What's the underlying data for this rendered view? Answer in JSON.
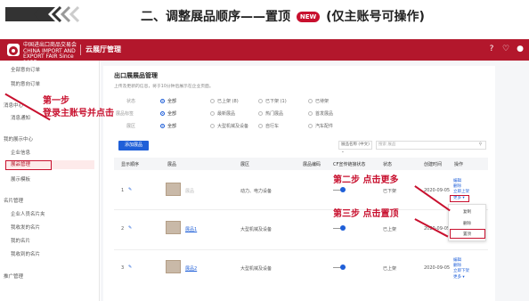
{
  "slide": {
    "title_prefix": "二、调整展品顺序——置顶",
    "new_badge": "NEW",
    "title_suffix": "(仅主账号可操作)"
  },
  "topbar": {
    "logo_text": "中国进出口商品交易会 CHINA IMPORT AND EXPORT FAIR Since 1957",
    "app_name": "云展厅管理",
    "icons": [
      "help-icon",
      "bell-icon",
      "user-icon"
    ]
  },
  "sidebar": {
    "items": [
      {
        "label": "全部意向订单",
        "active": false
      },
      {
        "label": "我的意向订单",
        "active": false
      },
      {
        "label": "消息中心",
        "active": false
      },
      {
        "label": "消息通知",
        "active": false
      },
      {
        "label": "我的展示中心",
        "active": false
      },
      {
        "label": "企业信息",
        "active": false
      },
      {
        "label": "展品管理",
        "active": true
      },
      {
        "label": "展示模板",
        "active": false
      },
      {
        "label": "名片管理",
        "active": false
      },
      {
        "label": "企业人员名片夹",
        "active": false
      },
      {
        "label": "我收发的名片",
        "active": false
      },
      {
        "label": "我的名片",
        "active": false
      },
      {
        "label": "我收到的名片",
        "active": false
      },
      {
        "label": "推广管理",
        "active": false
      }
    ]
  },
  "main": {
    "title": "出口展展品管理",
    "subtitle": "上传及更新的信息，将于10分钟后展示在企业页面。",
    "filters": [
      {
        "label": "状态",
        "options": [
          "全部",
          "已上架 (8)",
          "已下架 (1)",
          "已待架"
        ],
        "selected": 0
      },
      {
        "label": "展品标签",
        "options": [
          "全部",
          "最新展品",
          "热门展品",
          "首发展品"
        ],
        "selected": 0
      },
      {
        "label": "展区",
        "options": [
          "全部",
          "大型机械及设备",
          "自行车",
          "汽车配件"
        ],
        "selected": 0
      }
    ],
    "add_button": "添加展品",
    "select_value": "展品名称 (中文)",
    "search_placeholder": "搜索 展品",
    "table": {
      "headers": [
        "显示顺序",
        "展品",
        "展区",
        "展品编码",
        "CF宣传链接状态",
        "状态",
        "创建时间",
        "操作"
      ],
      "rows": [
        {
          "order": "1",
          "name": "展品",
          "zone": "动力、电力设备",
          "code": "",
          "status": "已下架",
          "time": "2020-09-05",
          "ops": [
            "编辑",
            "删除",
            "立即上架",
            "更多 ▾"
          ]
        },
        {
          "order": "2",
          "name": "展品1",
          "zone": "大型机械及设备",
          "code": "",
          "status": "已上架",
          "time": "2020-09-05",
          "ops": [
            "编辑",
            "删除"
          ]
        },
        {
          "order": "3",
          "name": "展品2",
          "zone": "大型机械及设备",
          "code": "",
          "status": "已上架",
          "time": "2020-09-05",
          "ops": [
            "编辑",
            "删除",
            "立即下架",
            "更多 ▾"
          ]
        }
      ]
    },
    "dropdown": [
      "复制",
      "删除",
      "置顶"
    ]
  },
  "annotations": {
    "step1_line1": "第一步",
    "step1_line2": "登录主账号并点击",
    "step2": "第二步  点击更多",
    "step3": "第三步  点击置顶"
  },
  "colors": {
    "brand_red": "#b3172c",
    "annotation_red": "#c8102e",
    "link_blue": "#1f5fd8"
  }
}
